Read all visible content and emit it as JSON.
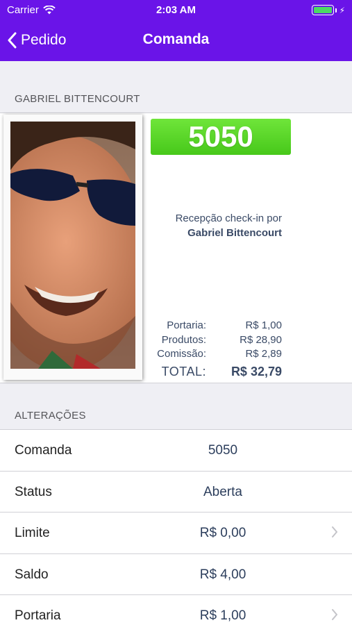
{
  "status_bar": {
    "carrier": "Carrier",
    "time": "2:03 AM"
  },
  "nav": {
    "back_label": "Pedido",
    "title": "Comanda"
  },
  "customer": {
    "section_title": "GABRIEL BITTENCOURT",
    "badge": "5050",
    "checkin_label": "Recepção check-in por",
    "checkin_name": "Gabriel Bittencourt",
    "summary": [
      {
        "label": "Portaria:",
        "value": "R$ 1,00"
      },
      {
        "label": "Produtos:",
        "value": "R$ 28,90"
      },
      {
        "label": "Comissão:",
        "value": "R$ 2,89"
      }
    ],
    "total_label": "TOTAL:",
    "total_value": "R$ 32,79"
  },
  "changes": {
    "section_title": "ALTERAÇÕES",
    "rows": [
      {
        "label": "Comanda",
        "value": "5050",
        "chevron": false
      },
      {
        "label": "Status",
        "value": "Aberta",
        "chevron": false
      },
      {
        "label": "Limite",
        "value": "R$ 0,00",
        "chevron": true
      },
      {
        "label": "Saldo",
        "value": "R$ 4,00",
        "chevron": false
      },
      {
        "label": "Portaria",
        "value": "R$ 1,00",
        "chevron": true
      }
    ]
  },
  "colors": {
    "nav_bar": "#6a14e8",
    "badge": "#55d024",
    "text_value": "#3a4a66",
    "background": "#efeff4"
  },
  "icons": [
    "wifi-icon",
    "battery-icon",
    "charging-bolt-icon",
    "chevron-left-icon",
    "chevron-right-icon",
    "profile-photo"
  ]
}
